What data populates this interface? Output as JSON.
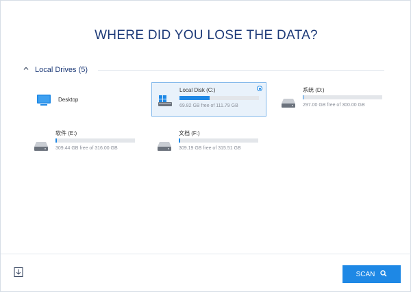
{
  "title": "WHERE DID YOU LOSE THE DATA?",
  "section": {
    "label": "Local Drives (5)"
  },
  "drives": [
    {
      "name": "Desktop",
      "free": "",
      "used_fraction": null
    },
    {
      "name": "Local Disk (C:)",
      "free": "69.82 GB free of 111.79 GB",
      "used_fraction": 0.375,
      "selected": true
    },
    {
      "name": "系统 (D:)",
      "free": "297.00 GB free of 300.00 GB",
      "used_fraction": 0.01
    },
    {
      "name": "软件 (E:)",
      "free": "309.44 GB free of 316.00 GB",
      "used_fraction": 0.021
    },
    {
      "name": "文档 (F:)",
      "free": "309.19 GB free of 315.51 GB",
      "used_fraction": 0.02
    }
  ],
  "scan_button": {
    "label": "SCAN",
    "icon": "search-icon"
  },
  "colors": {
    "accent": "#1e88e5",
    "title": "#1d3a78"
  }
}
